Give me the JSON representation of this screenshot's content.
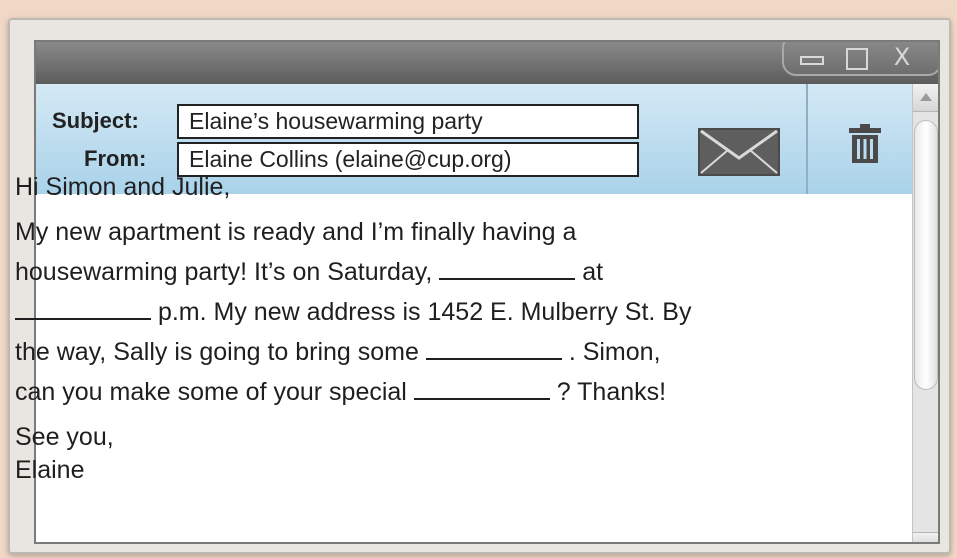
{
  "window": {
    "controls": [
      "minimize",
      "maximize",
      "close"
    ],
    "close_glyph": "X"
  },
  "header": {
    "subject_label": "Subject:",
    "subject_value": "Elaine’s housewarming party",
    "from_label": "From:",
    "from_value": "Elaine Collins (elaine@cup.org)",
    "icons": [
      "envelope-icon",
      "trash-icon"
    ]
  },
  "body": {
    "greeting": "Hi Simon and Julie,",
    "line1": "My new apartment is ready and I’m finally having a",
    "line2_a": "housewarming party! It’s on Saturday,",
    "line2_b": "at",
    "line3_b": "p.m. My new address is 1452 E. Mulberry St. By",
    "line4_a": "the way, Sally is going to bring some",
    "line4_b": ". Simon,",
    "line5_a": "can you make some of your special",
    "line5_b": "? Thanks!",
    "closing": "See you,",
    "signature": "Elaine"
  },
  "colors": {
    "header_blue": "#bfdff0",
    "titlebar_gray": "#6e6e6e",
    "background": "#f1d7c6"
  }
}
